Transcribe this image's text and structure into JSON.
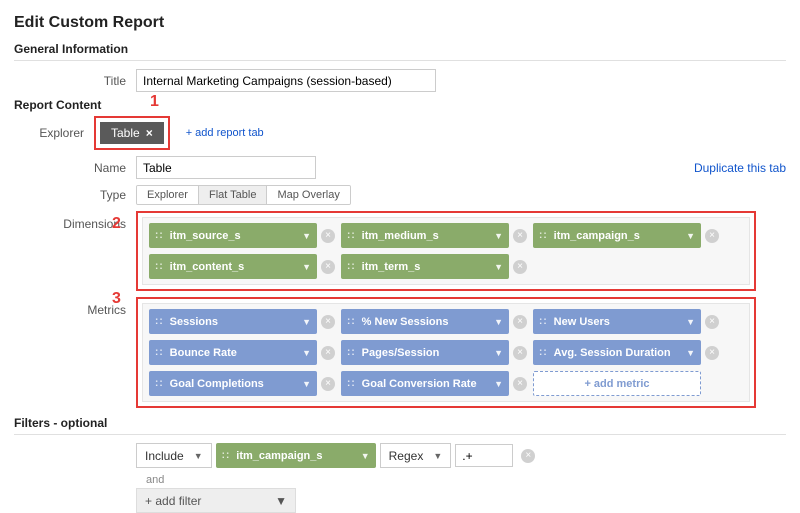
{
  "header": {
    "title": "Edit Custom Report"
  },
  "general": {
    "section": "General Information",
    "title_label": "Title",
    "title_value": "Internal Marketing Campaigns (session-based)"
  },
  "content": {
    "section": "Report Content",
    "tab_explorer": "Explorer",
    "tab_table": "Table",
    "add_tab": "+ add report tab",
    "name_label": "Name",
    "name_value": "Table",
    "duplicate": "Duplicate this tab",
    "type_label": "Type",
    "type_options": {
      "explorer": "Explorer",
      "flat": "Flat Table",
      "map": "Map Overlay"
    }
  },
  "dimensions": {
    "label": "Dimensions",
    "chips": [
      "itm_source_s",
      "itm_medium_s",
      "itm_campaign_s",
      "itm_content_s",
      "itm_term_s"
    ]
  },
  "metrics": {
    "label": "Metrics",
    "chips": [
      "Sessions",
      "% New Sessions",
      "New Users",
      "Bounce Rate",
      "Pages/Session",
      "Avg. Session Duration",
      "Goal Completions",
      "Goal Conversion Rate"
    ],
    "add_metric": "+ add metric"
  },
  "filters": {
    "label": "Filters",
    "optional": " - optional",
    "include": "Include",
    "dimension": "itm_campaign_s",
    "match": "Regex",
    "value": ".+",
    "and": "and",
    "add_filter": "+ add filter"
  },
  "callouts": {
    "one": "1",
    "two": "2",
    "three": "3"
  }
}
